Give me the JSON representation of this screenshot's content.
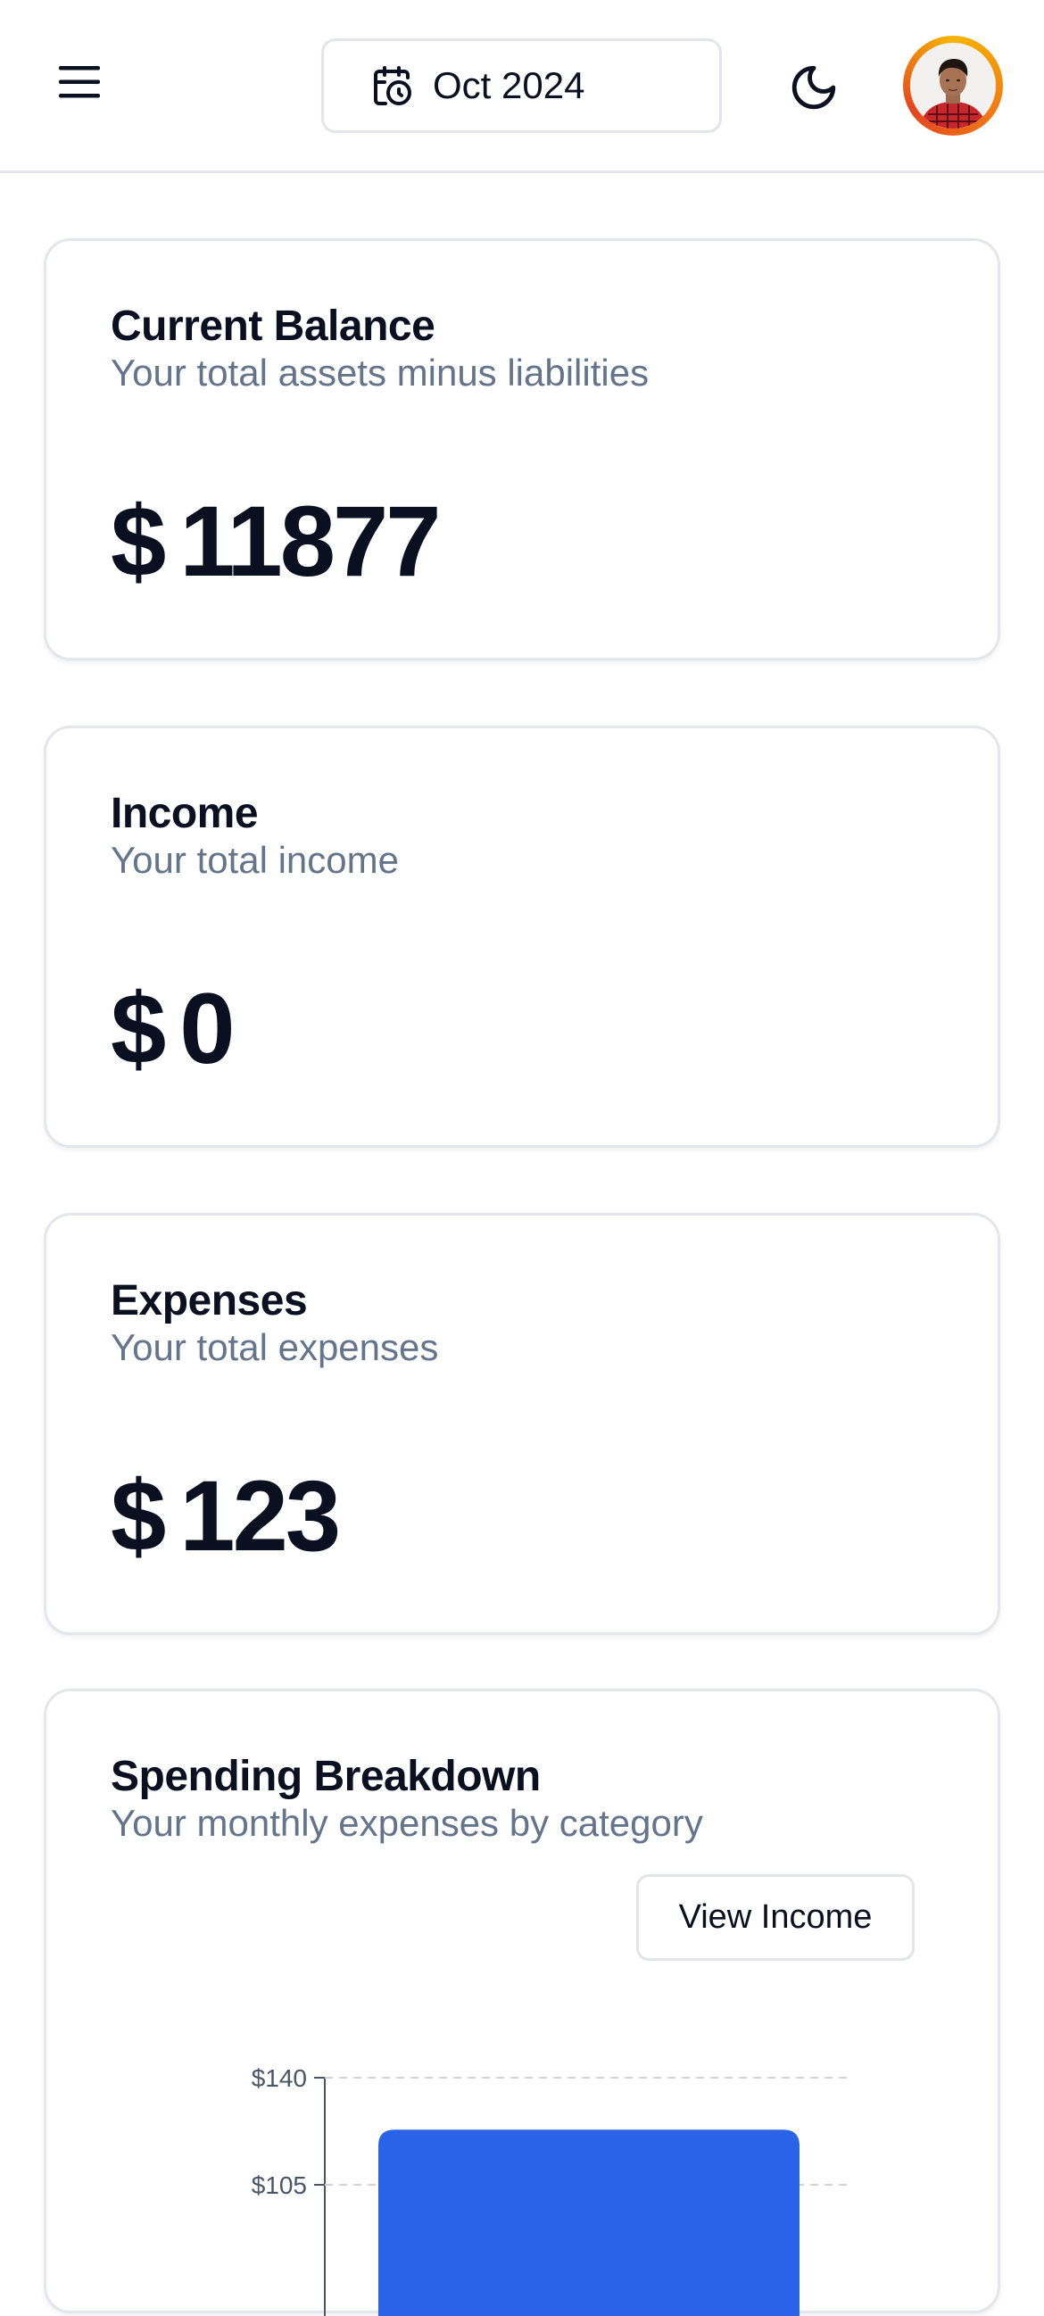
{
  "header": {
    "menu_icon": "hamburger-menu-icon",
    "date_icon": "calendar-clock-icon",
    "date_label": "Oct 2024",
    "theme_icon": "moon-icon",
    "avatar_alt": "user avatar"
  },
  "cards": {
    "balance": {
      "title": "Current Balance",
      "subtitle": "Your total assets minus liabilities",
      "currency": "$",
      "amount": "11877"
    },
    "income": {
      "title": "Income",
      "subtitle": "Your total income",
      "currency": "$",
      "amount": "0"
    },
    "expenses": {
      "title": "Expenses",
      "subtitle": "Your total expenses",
      "currency": "$",
      "amount": "123"
    }
  },
  "spending": {
    "title": "Spending Breakdown",
    "subtitle": "Your monthly expenses by category",
    "toggle_button": "View Income"
  },
  "colors": {
    "bar": "#2b63e8",
    "avatar_ring": "#f29a14"
  },
  "chart_data": {
    "type": "bar",
    "categories": [
      ""
    ],
    "values": [
      123
    ],
    "y_tick_labels": [
      "$140",
      "$105"
    ],
    "y_ticks": [
      140,
      105
    ],
    "ylim": [
      0,
      140
    ],
    "grid": "dashed horizontal",
    "legend": "none",
    "bar_color": "#2b63e8"
  }
}
